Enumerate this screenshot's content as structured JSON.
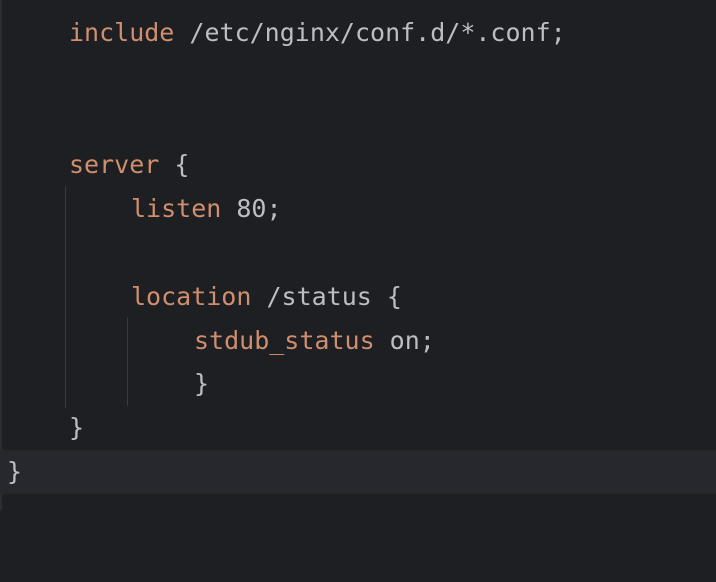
{
  "editor": {
    "lines": [
      {
        "keyword": "include",
        "rest": " /etc/nginx/conf.d/*.conf;"
      },
      {
        "keyword": "",
        "rest": ""
      },
      {
        "keyword": "",
        "rest": ""
      },
      {
        "keyword": "server",
        "rest": " {"
      },
      {
        "keyword": "listen",
        "rest": " 80;"
      },
      {
        "keyword": "",
        "rest": ""
      },
      {
        "keyword": "location",
        "rest": " /status {"
      },
      {
        "keyword": "stdub_status",
        "rest": " on;"
      },
      {
        "keyword": "",
        "rest": "}"
      },
      {
        "keyword": "",
        "rest": "}"
      },
      {
        "keyword": "",
        "rest": "}"
      }
    ]
  },
  "colors": {
    "background": "#1e1f22",
    "keyword": "#cf8e6d",
    "text": "#bcbec4",
    "current_line": "#26282e"
  }
}
